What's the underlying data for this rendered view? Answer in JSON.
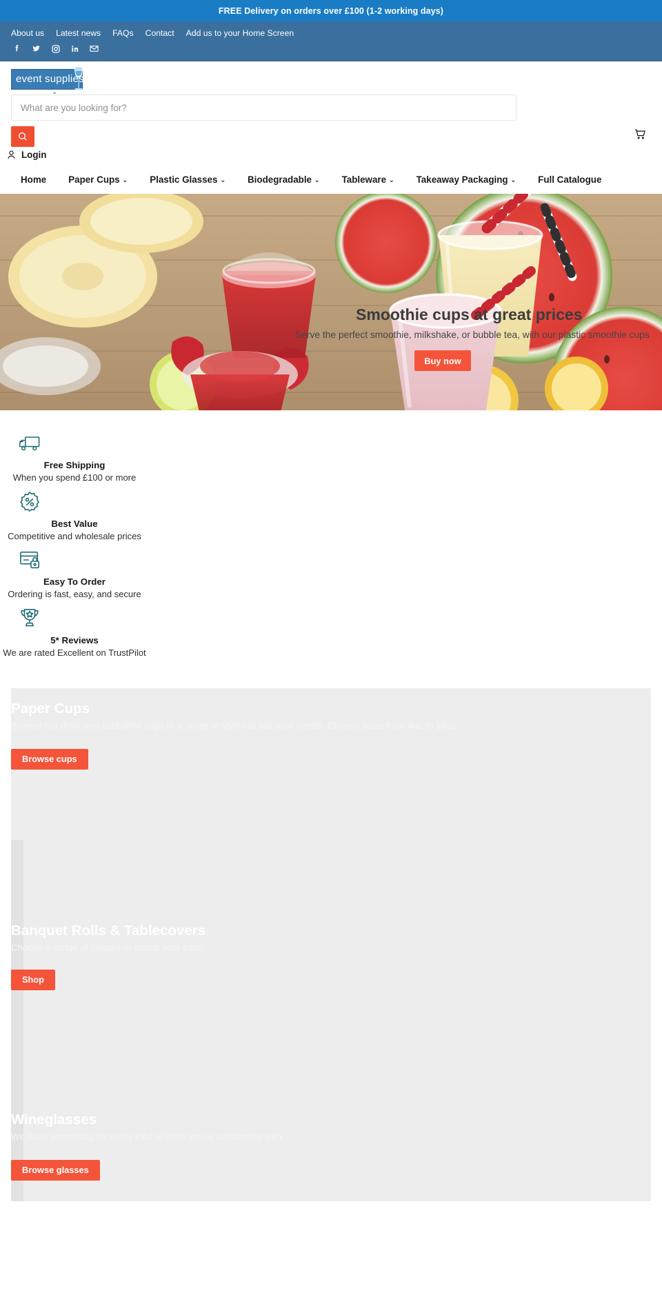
{
  "announcement": {
    "text": "FREE Delivery on orders over £100 (1-2 working days)",
    "bg": "#1a7cc4"
  },
  "utility": {
    "bg": "#3b6f9e",
    "links": [
      {
        "label": "About us"
      },
      {
        "label": "Latest news"
      },
      {
        "label": "FAQs"
      },
      {
        "label": "Contact"
      },
      {
        "label": "Add us to your Home Screen"
      }
    ],
    "social": [
      {
        "name": "facebook-icon",
        "title": "Facebook"
      },
      {
        "name": "twitter-icon",
        "title": "Twitter"
      },
      {
        "name": "instagram-icon",
        "title": "Instagram"
      },
      {
        "name": "linkedin-icon",
        "title": "LinkedIn"
      },
      {
        "name": "email-icon",
        "title": "Email"
      }
    ]
  },
  "header": {
    "logo_text": "event supplies",
    "search": {
      "placeholder": "What are you looking for?",
      "value": ""
    },
    "login_label": "Login",
    "accent": "#f04e31"
  },
  "nav": {
    "items": [
      {
        "label": "Home",
        "caret": false
      },
      {
        "label": "Paper Cups",
        "caret": true
      },
      {
        "label": "Plastic Glasses",
        "caret": true
      },
      {
        "label": "Biodegradable",
        "caret": true
      },
      {
        "label": "Tableware",
        "caret": true
      },
      {
        "label": "Takeaway Packaging",
        "caret": true
      },
      {
        "label": "Full Catalogue",
        "caret": false
      }
    ],
    "caret_glyph": "⌄"
  },
  "hero": {
    "title": "Smoothie cups at great prices",
    "subtitle": "Serve the perfect smoothie, milkshake, or bubble tea, with our plastic smoothie cups",
    "button": "Buy now",
    "button_color": "#f4543a"
  },
  "features": [
    {
      "icon": "delivery-truck-icon",
      "title": "Free Shipping",
      "desc": "When you spend £100 or more"
    },
    {
      "icon": "discount-badge-icon",
      "title": "Best Value",
      "desc": "Competitive and wholesale prices"
    },
    {
      "icon": "secure-card-icon",
      "title": "Easy To Order",
      "desc": "Ordering is fast, easy, and secure"
    },
    {
      "icon": "trophy-icon",
      "title": "5* Reviews",
      "desc": "We are rated Excellent on TrustPilot"
    }
  ],
  "categories": [
    {
      "title": "Paper Cups",
      "desc": "Browse hot drink and cold drink cups in a range of styles to suit your needs. Choose sizes from 4oz to 16oz.",
      "button": "Browse cups"
    },
    {
      "title": "Banquet Rolls & Tablecovers",
      "desc": "Choose a range of colours to match your table.",
      "button": "Shop"
    },
    {
      "title": "Wineglasses",
      "desc": "We have something for every kind of drink you're celebrating with.",
      "button": "Browse glasses"
    }
  ]
}
